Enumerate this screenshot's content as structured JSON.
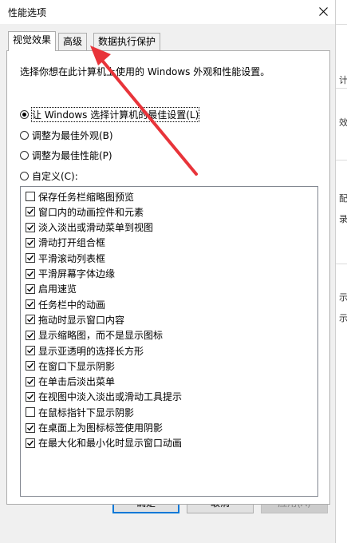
{
  "window": {
    "title": "性能选项",
    "close_icon": "close-icon"
  },
  "tabs": [
    {
      "label": "视觉效果",
      "active": true
    },
    {
      "label": "高级",
      "active": false
    },
    {
      "label": "数据执行保护",
      "active": false
    }
  ],
  "description": "选择你想在此计算机上使用的 Windows 外观和性能设置。",
  "radios": [
    {
      "label": "让 Windows 选择计算机的最佳设置(L)",
      "checked": true
    },
    {
      "label": "调整为最佳外观(B)",
      "checked": false
    },
    {
      "label": "调整为最佳性能(P)",
      "checked": false
    },
    {
      "label": "自定义(C):",
      "checked": false
    }
  ],
  "effects": [
    {
      "label": "保存任务栏缩略图预览",
      "checked": false
    },
    {
      "label": "窗口内的动画控件和元素",
      "checked": true
    },
    {
      "label": "淡入淡出或滑动菜单到视图",
      "checked": true
    },
    {
      "label": "滑动打开组合框",
      "checked": true
    },
    {
      "label": "平滑滚动列表框",
      "checked": true
    },
    {
      "label": "平滑屏幕字体边缘",
      "checked": true
    },
    {
      "label": "启用速览",
      "checked": true
    },
    {
      "label": "任务栏中的动画",
      "checked": true
    },
    {
      "label": "拖动时显示窗口内容",
      "checked": true
    },
    {
      "label": "显示缩略图，而不是显示图标",
      "checked": true
    },
    {
      "label": "显示亚透明的选择长方形",
      "checked": true
    },
    {
      "label": "在窗口下显示阴影",
      "checked": true
    },
    {
      "label": "在单击后淡出菜单",
      "checked": true
    },
    {
      "label": "在视图中淡入淡出或滑动工具提示",
      "checked": true
    },
    {
      "label": "在鼠标指针下显示阴影",
      "checked": false
    },
    {
      "label": "在桌面上为图标标签使用阴影",
      "checked": true
    },
    {
      "label": "在最大化和最小化时显示窗口动画",
      "checked": true
    }
  ],
  "buttons": {
    "ok": "确定",
    "cancel": "取消",
    "apply": "应用(A)"
  },
  "background_fragments": [
    "计大",
    "效",
    "配",
    "录",
    "示",
    "示"
  ],
  "annotation": {
    "arrow_color": "#e8343a"
  }
}
